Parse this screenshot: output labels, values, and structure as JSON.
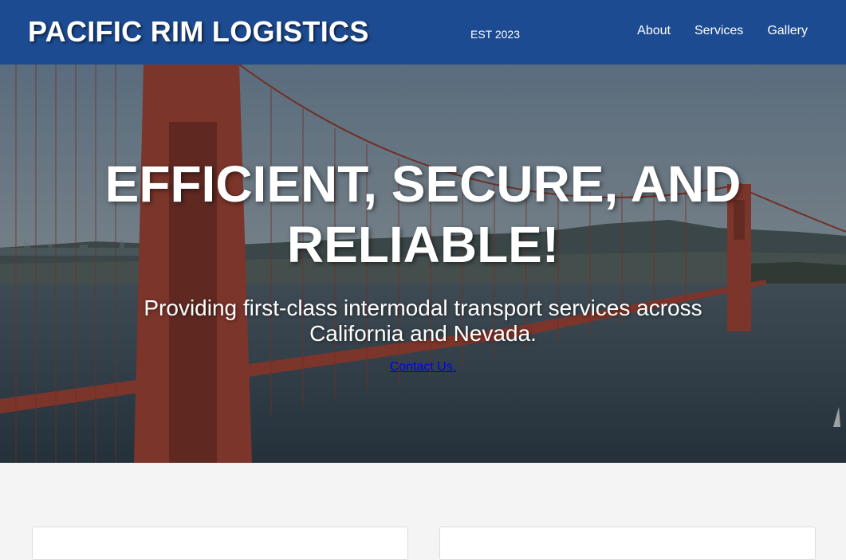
{
  "header": {
    "brand": "PACIFIC RIM LOGISTICS",
    "established": "EST 2023",
    "nav": [
      {
        "label": "About"
      },
      {
        "label": "Services"
      },
      {
        "label": "Gallery"
      }
    ]
  },
  "hero": {
    "title": "EFFICIENT, SECURE, AND RELIABLE!",
    "subtitle": "Providing first-class intermodal transport services across California and Nevada.",
    "cta_label": "Contact Us."
  },
  "colors": {
    "header_bg": "#1d4b91",
    "page_bg": "#f4f4f4",
    "link": "#0000ee",
    "bridge": "#b2432b"
  }
}
